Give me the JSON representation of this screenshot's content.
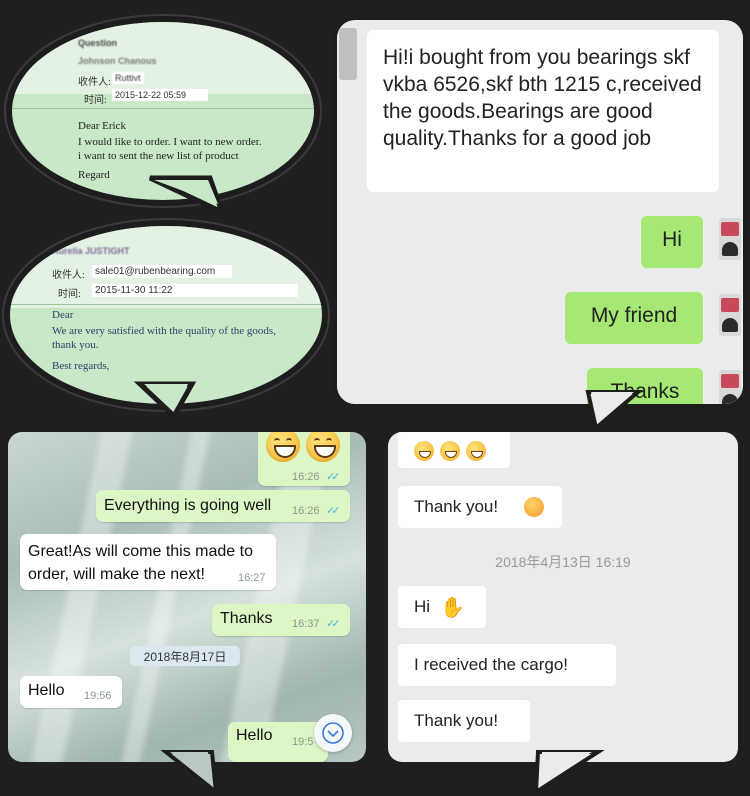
{
  "email1": {
    "header_label": "Question",
    "sender_name": "Johnson Chanous",
    "to_label": "收件人:",
    "to_value": "Ruttivt",
    "time_label": "时间:",
    "time_value": "2015-12-22 05:59",
    "greeting": "Dear Erick",
    "line1": "I would like to order. I want to new order.",
    "line2": "i want to sent the new list of product",
    "closing": "Regard"
  },
  "email2": {
    "sender_name": "Aurelia JUSTIGHT",
    "to_label": "收件人:",
    "to_value": "sale01@rubenbearing.com",
    "time_label": "时间:",
    "time_value": "2015-11-30 11:22",
    "greeting": "Dear",
    "line1": "We are very satisfied with the quality of the goods,",
    "line2": "thank you.",
    "closing": "Best regards,"
  },
  "wechat1": {
    "incoming_message": "Hi!i bought from you bearings skf vkba 6526,skf bth 1215 c,received the goods.Bearings are good quality.Thanks for a good job",
    "outgoing": [
      "Hi",
      "My friend",
      "Thanks"
    ]
  },
  "whatsapp": {
    "msg_emoji_time": "16:26",
    "msg_going_well": "Everything is going well",
    "msg_going_well_time": "16:26",
    "msg_great": "Great!As will come this made to order, will make the next!",
    "msg_great_time": "16:27",
    "msg_thanks": "Thanks",
    "msg_thanks_time": "16:37",
    "date_chip": "2018年8月17日",
    "msg_hello_in": "Hello",
    "msg_hello_in_time": "19:56",
    "msg_hello_out": "Hello",
    "msg_hello_out_time": "19:5"
  },
  "wechat2": {
    "thank_you_1": "Thank you!",
    "timestamp": "2018年4月13日 16:19",
    "hi": "Hi",
    "received": "I received the cargo!",
    "thank_you_2": "Thank you!"
  },
  "colors": {
    "background": "#1f1f1f",
    "wechat_green": "#a5e873",
    "whatsapp_green": "#dcf7c5",
    "email_green": "#c9e8c8"
  }
}
